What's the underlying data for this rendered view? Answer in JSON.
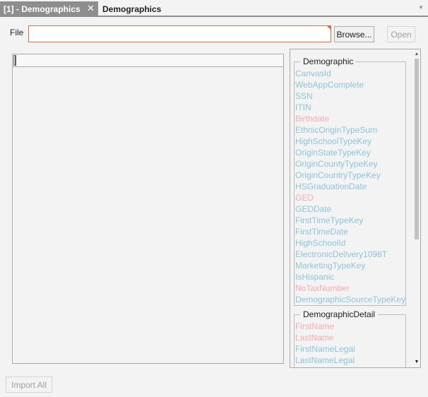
{
  "tabs": [
    {
      "label": "[1] - Demographics",
      "active": true
    },
    {
      "label": "Demographics",
      "active": false
    }
  ],
  "file": {
    "label": "File",
    "value": "",
    "placeholder": "",
    "browse_label": "Browse...",
    "open_label": "Open"
  },
  "footer": {
    "import_all_label": "Import All"
  },
  "colors": {
    "field_normal": "#8dc4da",
    "field_required": "#f5aab0",
    "validation_border": "#d4714a",
    "active_tab": "#8e8e8e"
  },
  "groups": [
    {
      "title": "Demographic",
      "fields": [
        {
          "name": "CanvasId",
          "required": false
        },
        {
          "name": "WebAppComplete",
          "required": false
        },
        {
          "name": "SSN",
          "required": false
        },
        {
          "name": "ITIN",
          "required": false
        },
        {
          "name": "Birthdate",
          "required": true
        },
        {
          "name": "EthnicOriginTypeSum",
          "required": false
        },
        {
          "name": "HighSchoolTypeKey",
          "required": false
        },
        {
          "name": "OriginStateTypeKey",
          "required": false
        },
        {
          "name": "OriginCountyTypeKey",
          "required": false
        },
        {
          "name": "OriginCountryTypeKey",
          "required": false
        },
        {
          "name": "HSGraduationDate",
          "required": false
        },
        {
          "name": "GED",
          "required": true
        },
        {
          "name": "GEDDate",
          "required": false
        },
        {
          "name": "FirstTimeTypeKey",
          "required": false
        },
        {
          "name": "FirstTimeDate",
          "required": false
        },
        {
          "name": "HighSchoolId",
          "required": false
        },
        {
          "name": "ElectronicDelivery1098T",
          "required": false
        },
        {
          "name": "MarketingTypeKey",
          "required": false
        },
        {
          "name": "IsHispanic",
          "required": false
        },
        {
          "name": "NoTaxNumber",
          "required": true
        },
        {
          "name": "DemographicSourceTypeKey",
          "required": false
        }
      ]
    },
    {
      "title": "DemographicDetail",
      "fields": [
        {
          "name": "FirstName",
          "required": true
        },
        {
          "name": "LastName",
          "required": true
        },
        {
          "name": "FirstNameLegal",
          "required": false
        },
        {
          "name": "LastNameLegal",
          "required": false
        }
      ]
    }
  ]
}
